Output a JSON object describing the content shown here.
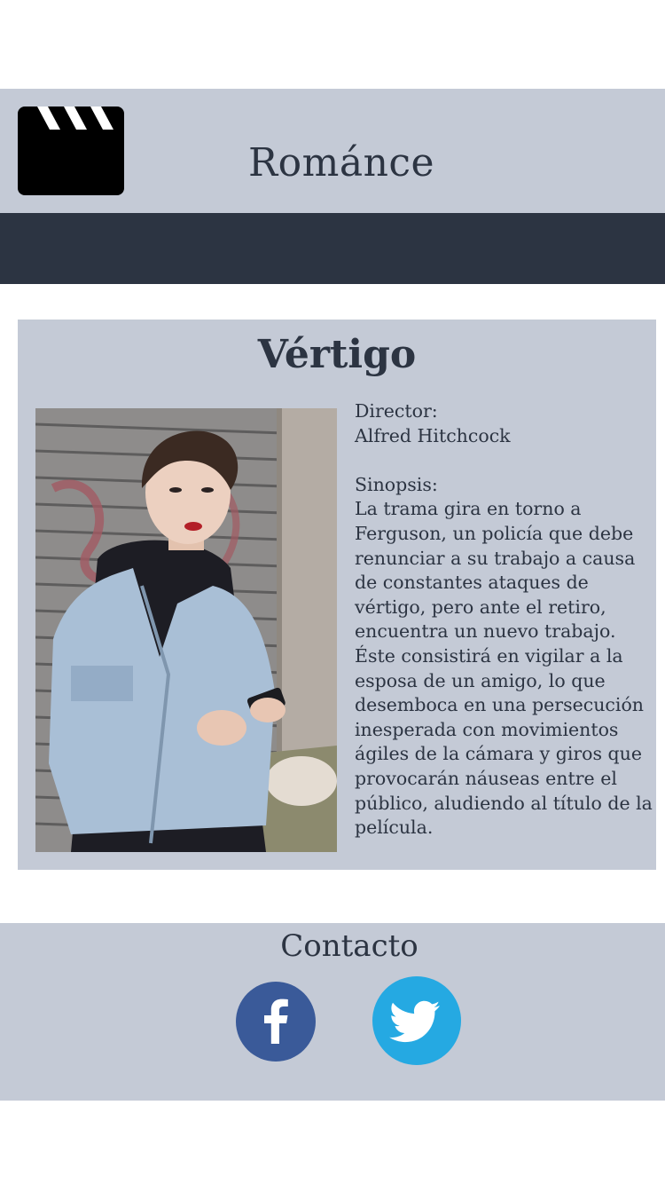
{
  "header": {
    "icon": "clapperboard-icon",
    "title": "Románce"
  },
  "movie": {
    "title": "Vértigo",
    "poster_alt": "Mujer con chaqueta de mezclilla sosteniendo un teléfono",
    "director_label": "Director:",
    "director": "Alfred Hitchcock",
    "synopsis_label": "Sinopsis:",
    "synopsis": "La trama gira en torno a Ferguson, un policía que debe renunciar a su trabajo a causa de constantes ataques de vértigo, pero ante el retiro, encuentra un nuevo trabajo. Éste consistirá en vigilar a la esposa de un amigo, lo que desemboca en una persecución inesperada con movimientos ágiles de la cámara y giros que provocarán náuseas entre el público, aludiendo al título de la película."
  },
  "footer": {
    "title": "Contacto",
    "social": [
      {
        "name": "facebook",
        "icon": "facebook-icon",
        "color": "#3a5a99"
      },
      {
        "name": "twitter",
        "icon": "twitter-icon",
        "color": "#25a9e2"
      }
    ]
  },
  "colors": {
    "panel": "#c4cad6",
    "dark": "#2c3442",
    "text": "#2c3442"
  }
}
